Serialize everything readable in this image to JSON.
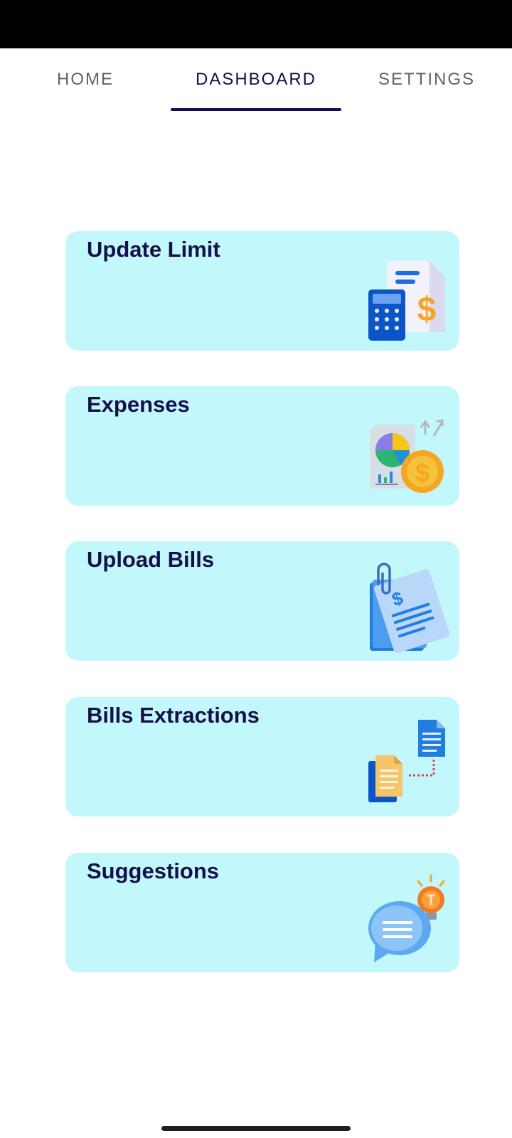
{
  "tabs": {
    "home": "HOME",
    "dashboard": "DASHBOARD",
    "settings": "SETTINGS",
    "active": "DASHBOARD"
  },
  "cards": [
    {
      "title": "Update Limit",
      "icon": "calculator-invoice-icon"
    },
    {
      "title": "Expenses",
      "icon": "pie-chart-coin-icon"
    },
    {
      "title": "Upload Bills",
      "icon": "bill-document-icon"
    },
    {
      "title": "Bills Extractions",
      "icon": "document-transfer-icon"
    },
    {
      "title": "Suggestions",
      "icon": "chat-lightbulb-icon"
    }
  ],
  "colors": {
    "card_background": "#c2f8fc",
    "title_text": "#14104a",
    "tab_inactive": "#5f6368",
    "tab_indicator": "#14104a",
    "status_bar": "#000000"
  }
}
